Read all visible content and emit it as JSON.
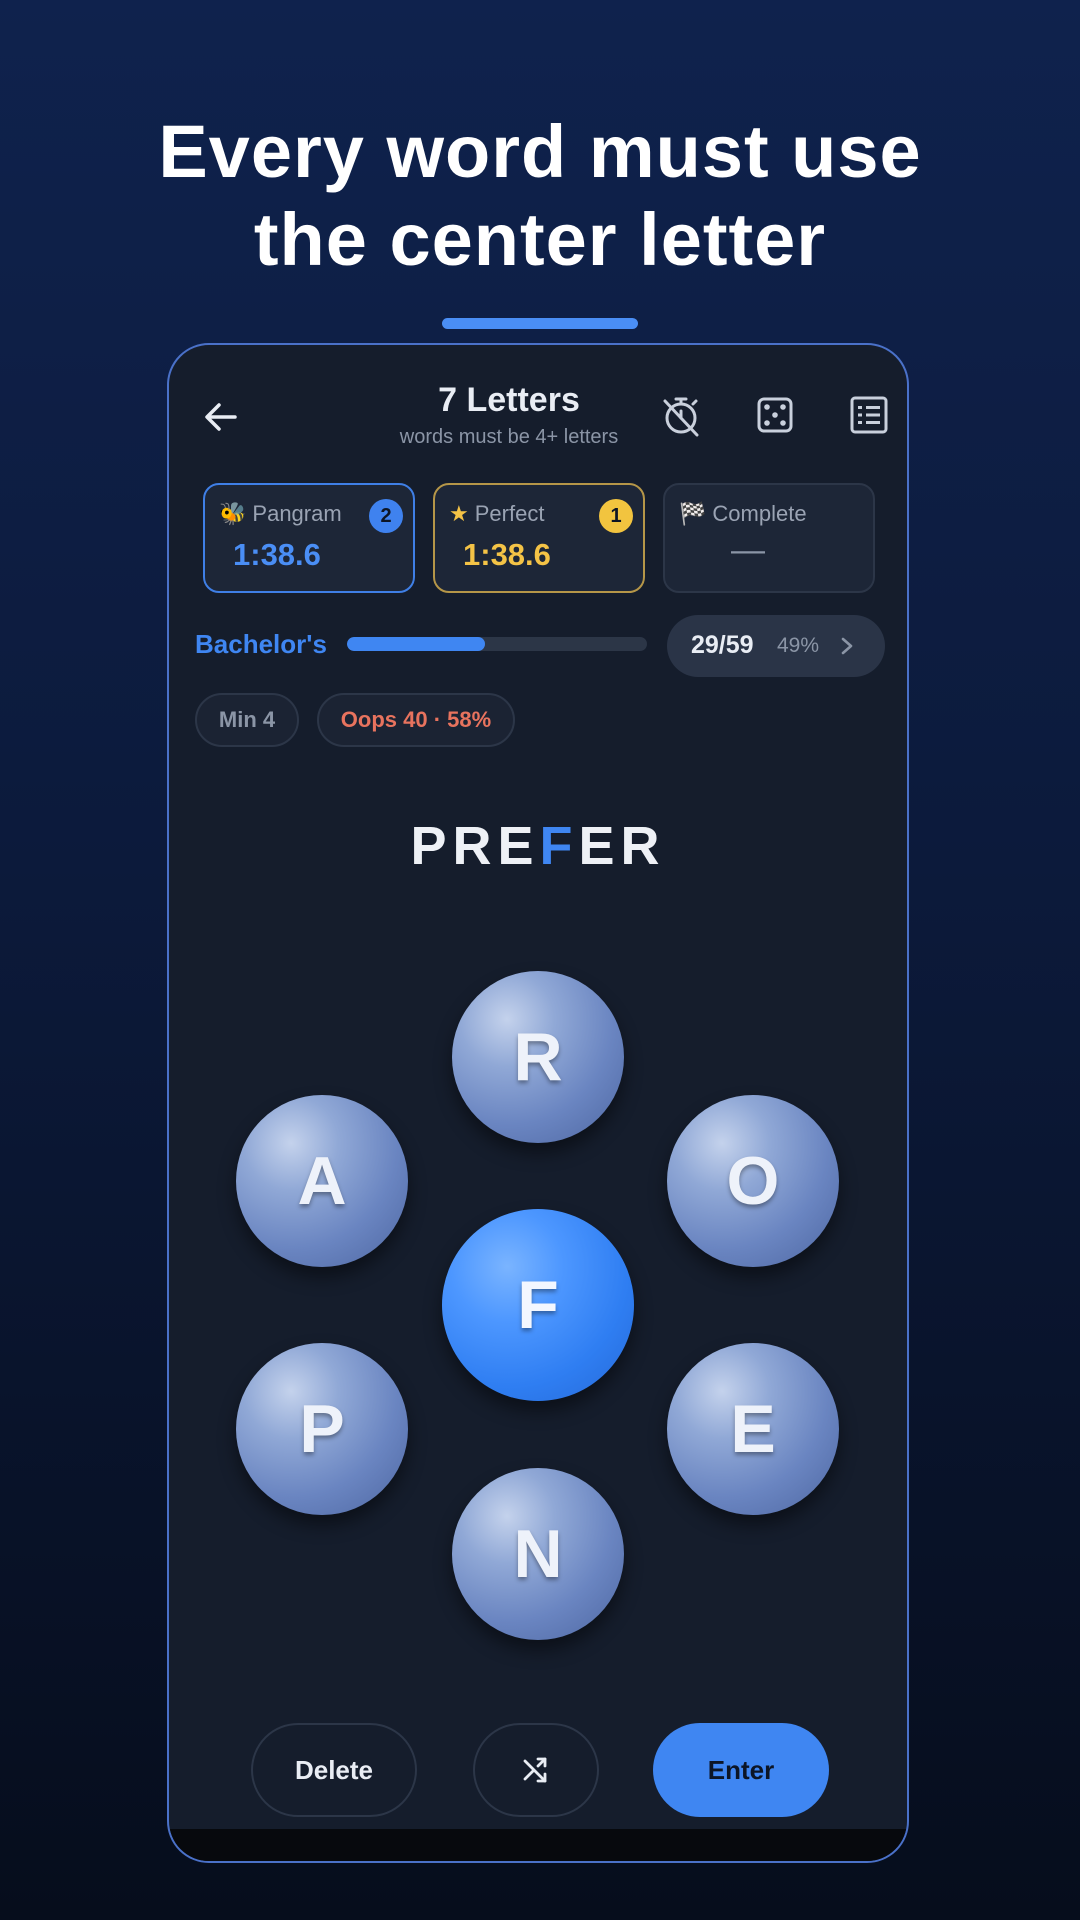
{
  "promo": {
    "headline_line1": "Every word must use",
    "headline_line2": "the center letter"
  },
  "header": {
    "title": "7 Letters",
    "subtitle": "words must be 4+ letters"
  },
  "stats": {
    "pangram": {
      "icon": "🐝",
      "label": "Pangram",
      "value": "1:38.6",
      "badge": "2"
    },
    "perfect": {
      "icon": "★",
      "label": "Perfect",
      "value": "1:38.6",
      "badge": "1"
    },
    "complete": {
      "icon": "🏁",
      "label": "Complete",
      "value": "—"
    }
  },
  "progress": {
    "rank": "Bachelor's",
    "fraction": 0.46,
    "count": "29/59",
    "percent": "49%"
  },
  "chips": {
    "min": "Min 4",
    "oops": "Oops 40 · 58%"
  },
  "current_word": {
    "before": "PRE",
    "highlight": "F",
    "after": "ER"
  },
  "letters": {
    "center": "F",
    "top": "R",
    "upper_left": "A",
    "upper_right": "O",
    "lower_left": "P",
    "lower_right": "E",
    "bottom": "N"
  },
  "buttons": {
    "delete": "Delete",
    "enter": "Enter"
  },
  "colors": {
    "accent": "#3f86f2",
    "gold": "#f4c346",
    "oops": "#e8735e"
  }
}
